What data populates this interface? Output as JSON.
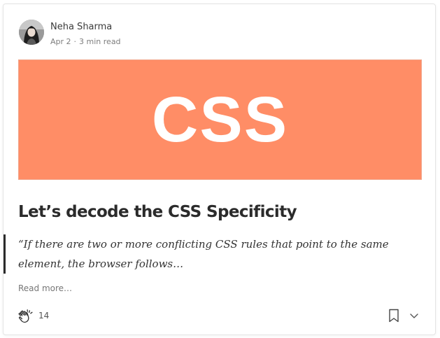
{
  "author": {
    "name": "Neha Sharma",
    "date": "Apr 2",
    "read_time": "3 min read",
    "separator": "·"
  },
  "hero": {
    "text": "CSS",
    "background": "#ff8d66"
  },
  "article": {
    "title": "Let’s decode the CSS Specificity",
    "excerpt": "“If there are two or more conflicting CSS rules that point to the same element, the browser follows…",
    "read_more": "Read more…"
  },
  "footer": {
    "clap_count": "14",
    "icons": [
      "clap-icon",
      "bookmark-icon",
      "chevron-down-icon"
    ]
  }
}
